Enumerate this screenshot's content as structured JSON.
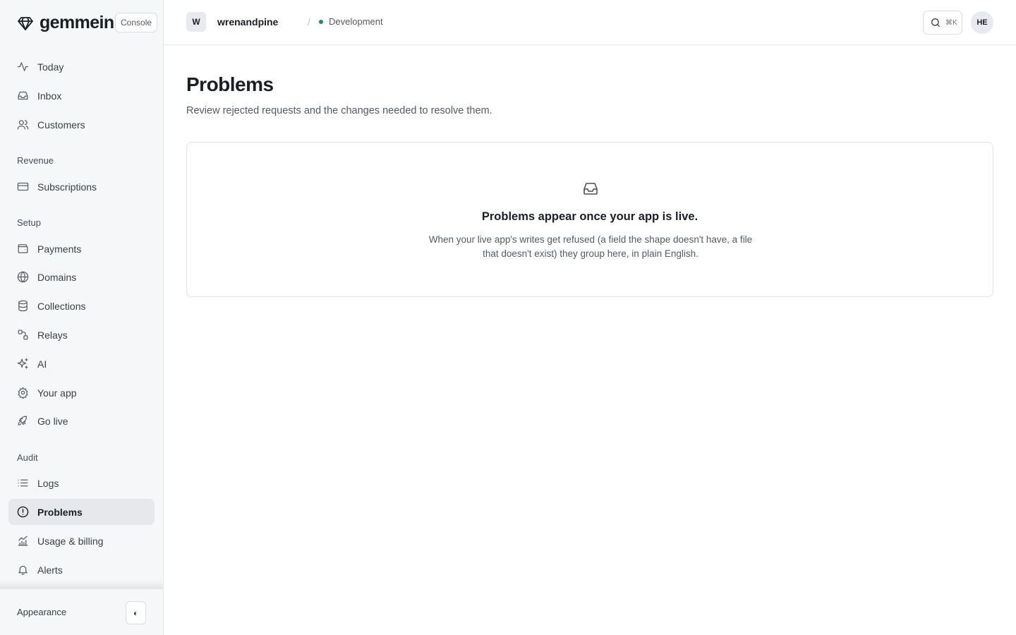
{
  "brand": {
    "name": "gemmein",
    "badge": "Console"
  },
  "nav": {
    "main": [
      {
        "label": "Today",
        "icon": "activity-icon"
      },
      {
        "label": "Inbox",
        "icon": "inbox-icon"
      },
      {
        "label": "Customers",
        "icon": "users-icon"
      }
    ],
    "sections": {
      "revenue": "Revenue",
      "setup": "Setup",
      "audit": "Audit"
    },
    "revenue": [
      {
        "label": "Subscriptions",
        "icon": "credit-card-icon"
      }
    ],
    "setup": [
      {
        "label": "Payments",
        "icon": "wallet-icon"
      },
      {
        "label": "Domains",
        "icon": "globe-icon"
      },
      {
        "label": "Collections",
        "icon": "database-icon"
      },
      {
        "label": "Relays",
        "icon": "relay-icon"
      },
      {
        "label": "AI",
        "icon": "sparkles-icon"
      },
      {
        "label": "Your app",
        "icon": "gear-icon"
      },
      {
        "label": "Go live",
        "icon": "rocket-icon"
      }
    ],
    "audit": [
      {
        "label": "Logs",
        "icon": "list-icon"
      },
      {
        "label": "Problems",
        "icon": "alert-circle-icon",
        "active": true
      },
      {
        "label": "Usage & billing",
        "icon": "chart-icon"
      },
      {
        "label": "Alerts",
        "icon": "bell-icon"
      }
    ]
  },
  "footer": {
    "appearance_label": "Appearance",
    "toggle_glyph": "◐"
  },
  "topbar": {
    "workspace_initial": "W",
    "workspace_name": "wrenandpine",
    "separator": "/",
    "environment": "Development",
    "search_shortcut": "⌘K",
    "user_initials": "HE"
  },
  "page": {
    "title": "Problems",
    "subtitle": "Review rejected requests and the changes needed to resolve them."
  },
  "empty_state": {
    "icon": "inbox-icon",
    "title": "Problems appear once your app is live.",
    "description": "When your live app's writes get refused (a field the shape doesn't have, a file that doesn't exist) they group here, in plain English."
  },
  "colors": {
    "sidebar_bg": "#f6f7f8",
    "active_item_bg": "#e6e8eb",
    "environment_dot": "#1f8a5b",
    "text_primary": "#1b1f24"
  }
}
